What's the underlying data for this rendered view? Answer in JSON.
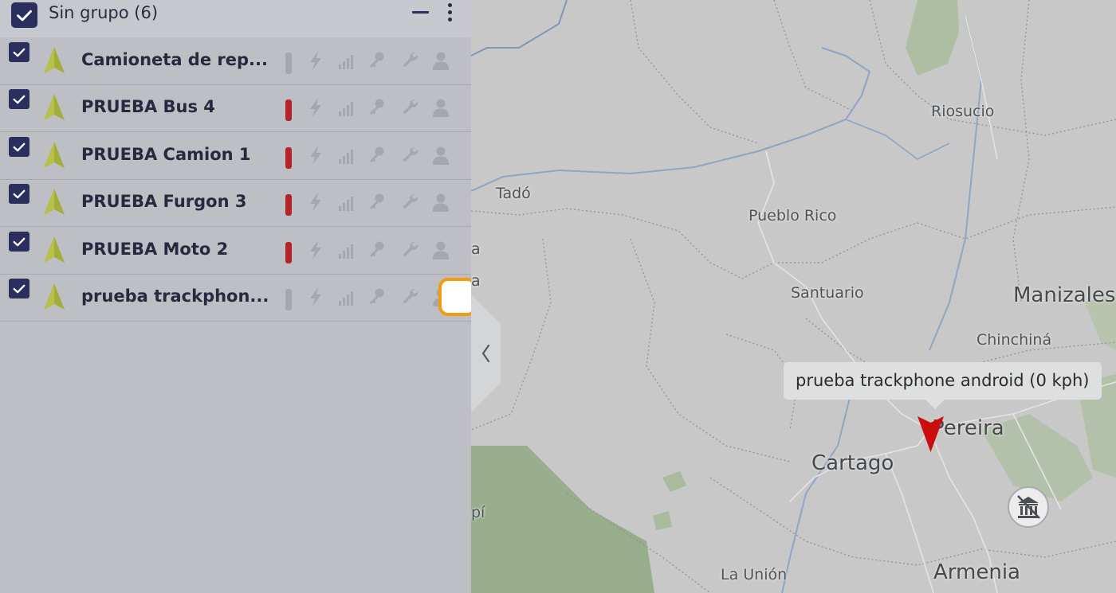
{
  "group": {
    "title": "Sin grupo (6)"
  },
  "vehicles": [
    {
      "name": "Camioneta de rep...",
      "status_color": "#a4a7ad"
    },
    {
      "name": "PRUEBA Bus 4",
      "status_color": "#b4252b"
    },
    {
      "name": "PRUEBA Camion 1",
      "status_color": "#b4252b"
    },
    {
      "name": "PRUEBA Furgon 3",
      "status_color": "#b4252b"
    },
    {
      "name": "PRUEBA Moto 2",
      "status_color": "#b4252b"
    },
    {
      "name": "prueba trackphon...",
      "status_color": "#a4a7ad"
    }
  ],
  "map": {
    "labels": {
      "tado": "Tadó",
      "riosucio": "Riosucio",
      "pueblo_rico": "Pueblo Rico",
      "santuario": "Santuario",
      "manizales": "Manizales",
      "chinchina": "Chinchiná",
      "pereira": "Pereira",
      "cartago": "Cartago",
      "la_union": "La Unión",
      "armenia": "Armenia",
      "edge_a": "a",
      "edge_a2": "a",
      "edge_pi": "pí"
    },
    "tooltip": "prueba trackphone android (0 kph)"
  },
  "colors": {
    "accent": "#2a2f5e",
    "status_inactive": "#a4a7ad",
    "status_offline": "#b4252b",
    "vehicle_arrow": "#a3ad3a",
    "marker": "#cc0d0d",
    "focus": "#f39c12"
  },
  "icons": {
    "row": [
      "navigation-arrow-icon",
      "status-bar-icon",
      "power-icon",
      "signal-icon",
      "ignition-key-icon",
      "maintenance-wrench-icon",
      "driver-icon"
    ],
    "map": [
      "collapse-chevron-icon",
      "museum-icon"
    ]
  }
}
